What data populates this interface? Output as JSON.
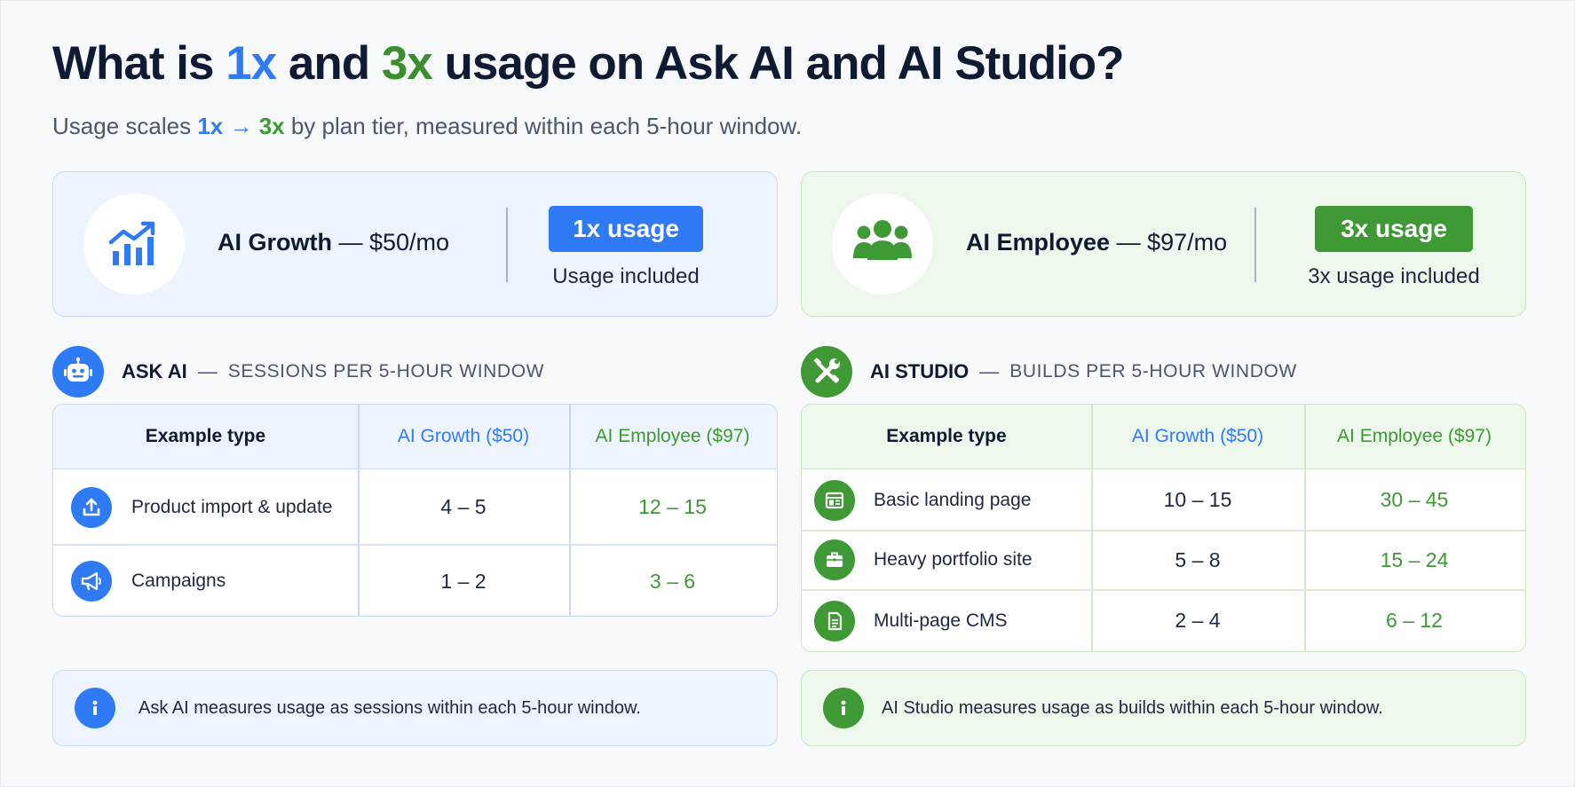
{
  "title": {
    "part1": "What is ",
    "x1": "1x",
    "part2": " and ",
    "x3": "3x",
    "part3": " usage on Ask AI and AI Studio?"
  },
  "subtitle": {
    "part1": "Usage scales ",
    "x1": "1x",
    "arrow": "→",
    "x3": "3x",
    "part2": " by plan tier, measured within each 5-hour window."
  },
  "plans": [
    {
      "icon": "growth-chart-icon",
      "name": "AI Growth",
      "price": " — $50/mo",
      "badge": "1x usage",
      "note": "Usage included",
      "accent": "#2f7bf5"
    },
    {
      "icon": "team-icon",
      "name": "AI Employee",
      "price": " — $97/mo",
      "badge": "3x usage",
      "note": "3x usage included",
      "accent": "#3f9a36"
    }
  ],
  "ask_ai": {
    "icon": "robot-icon",
    "name": "ASK AI",
    "dash": "—",
    "desc": "SESSIONS PER 5-HOUR WINDOW",
    "headers": [
      "Example type",
      "AI Growth ($50)",
      "AI Employee ($97)"
    ],
    "rows": [
      {
        "icon": "upload-icon",
        "label": "Product import & update",
        "growth": "4 – 5",
        "employee": "12 – 15"
      },
      {
        "icon": "megaphone-icon",
        "label": "Campaigns",
        "growth": "1 – 2",
        "employee": "3 – 6"
      }
    ],
    "info": "Ask AI measures usage as sessions within each 5-hour window."
  },
  "ai_studio": {
    "icon": "tools-icon",
    "name": "AI STUDIO",
    "dash": "—",
    "desc": "BUILDS PER 5-HOUR WINDOW",
    "headers": [
      "Example type",
      "AI Growth ($50)",
      "AI Employee ($97)"
    ],
    "rows": [
      {
        "icon": "landing-page-icon",
        "label": "Basic landing page",
        "growth": "10 – 15",
        "employee": "30 – 45"
      },
      {
        "icon": "briefcase-icon",
        "label": "Heavy portfolio site",
        "growth": "5 – 8",
        "employee": "15 – 24"
      },
      {
        "icon": "document-icon",
        "label": "Multi-page CMS",
        "growth": "2 – 4",
        "employee": "6 – 12"
      }
    ],
    "info": "AI Studio measures usage as builds within each 5-hour window."
  },
  "info_icon": "info-icon"
}
